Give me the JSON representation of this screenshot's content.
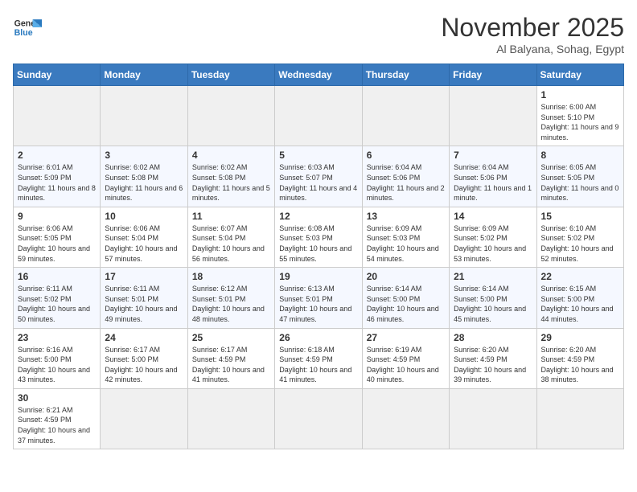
{
  "header": {
    "logo_general": "General",
    "logo_blue": "Blue",
    "title": "November 2025",
    "subtitle": "Al Balyana, Sohag, Egypt"
  },
  "weekdays": [
    "Sunday",
    "Monday",
    "Tuesday",
    "Wednesday",
    "Thursday",
    "Friday",
    "Saturday"
  ],
  "weeks": [
    [
      {
        "day": "",
        "info": ""
      },
      {
        "day": "",
        "info": ""
      },
      {
        "day": "",
        "info": ""
      },
      {
        "day": "",
        "info": ""
      },
      {
        "day": "",
        "info": ""
      },
      {
        "day": "",
        "info": ""
      },
      {
        "day": "1",
        "info": "Sunrise: 6:00 AM\nSunset: 5:10 PM\nDaylight: 11 hours and 9 minutes."
      }
    ],
    [
      {
        "day": "2",
        "info": "Sunrise: 6:01 AM\nSunset: 5:09 PM\nDaylight: 11 hours and 8 minutes."
      },
      {
        "day": "3",
        "info": "Sunrise: 6:02 AM\nSunset: 5:08 PM\nDaylight: 11 hours and 6 minutes."
      },
      {
        "day": "4",
        "info": "Sunrise: 6:02 AM\nSunset: 5:08 PM\nDaylight: 11 hours and 5 minutes."
      },
      {
        "day": "5",
        "info": "Sunrise: 6:03 AM\nSunset: 5:07 PM\nDaylight: 11 hours and 4 minutes."
      },
      {
        "day": "6",
        "info": "Sunrise: 6:04 AM\nSunset: 5:06 PM\nDaylight: 11 hours and 2 minutes."
      },
      {
        "day": "7",
        "info": "Sunrise: 6:04 AM\nSunset: 5:06 PM\nDaylight: 11 hours and 1 minute."
      },
      {
        "day": "8",
        "info": "Sunrise: 6:05 AM\nSunset: 5:05 PM\nDaylight: 11 hours and 0 minutes."
      }
    ],
    [
      {
        "day": "9",
        "info": "Sunrise: 6:06 AM\nSunset: 5:05 PM\nDaylight: 10 hours and 59 minutes."
      },
      {
        "day": "10",
        "info": "Sunrise: 6:06 AM\nSunset: 5:04 PM\nDaylight: 10 hours and 57 minutes."
      },
      {
        "day": "11",
        "info": "Sunrise: 6:07 AM\nSunset: 5:04 PM\nDaylight: 10 hours and 56 minutes."
      },
      {
        "day": "12",
        "info": "Sunrise: 6:08 AM\nSunset: 5:03 PM\nDaylight: 10 hours and 55 minutes."
      },
      {
        "day": "13",
        "info": "Sunrise: 6:09 AM\nSunset: 5:03 PM\nDaylight: 10 hours and 54 minutes."
      },
      {
        "day": "14",
        "info": "Sunrise: 6:09 AM\nSunset: 5:02 PM\nDaylight: 10 hours and 53 minutes."
      },
      {
        "day": "15",
        "info": "Sunrise: 6:10 AM\nSunset: 5:02 PM\nDaylight: 10 hours and 52 minutes."
      }
    ],
    [
      {
        "day": "16",
        "info": "Sunrise: 6:11 AM\nSunset: 5:02 PM\nDaylight: 10 hours and 50 minutes."
      },
      {
        "day": "17",
        "info": "Sunrise: 6:11 AM\nSunset: 5:01 PM\nDaylight: 10 hours and 49 minutes."
      },
      {
        "day": "18",
        "info": "Sunrise: 6:12 AM\nSunset: 5:01 PM\nDaylight: 10 hours and 48 minutes."
      },
      {
        "day": "19",
        "info": "Sunrise: 6:13 AM\nSunset: 5:01 PM\nDaylight: 10 hours and 47 minutes."
      },
      {
        "day": "20",
        "info": "Sunrise: 6:14 AM\nSunset: 5:00 PM\nDaylight: 10 hours and 46 minutes."
      },
      {
        "day": "21",
        "info": "Sunrise: 6:14 AM\nSunset: 5:00 PM\nDaylight: 10 hours and 45 minutes."
      },
      {
        "day": "22",
        "info": "Sunrise: 6:15 AM\nSunset: 5:00 PM\nDaylight: 10 hours and 44 minutes."
      }
    ],
    [
      {
        "day": "23",
        "info": "Sunrise: 6:16 AM\nSunset: 5:00 PM\nDaylight: 10 hours and 43 minutes."
      },
      {
        "day": "24",
        "info": "Sunrise: 6:17 AM\nSunset: 5:00 PM\nDaylight: 10 hours and 42 minutes."
      },
      {
        "day": "25",
        "info": "Sunrise: 6:17 AM\nSunset: 4:59 PM\nDaylight: 10 hours and 41 minutes."
      },
      {
        "day": "26",
        "info": "Sunrise: 6:18 AM\nSunset: 4:59 PM\nDaylight: 10 hours and 41 minutes."
      },
      {
        "day": "27",
        "info": "Sunrise: 6:19 AM\nSunset: 4:59 PM\nDaylight: 10 hours and 40 minutes."
      },
      {
        "day": "28",
        "info": "Sunrise: 6:20 AM\nSunset: 4:59 PM\nDaylight: 10 hours and 39 minutes."
      },
      {
        "day": "29",
        "info": "Sunrise: 6:20 AM\nSunset: 4:59 PM\nDaylight: 10 hours and 38 minutes."
      }
    ],
    [
      {
        "day": "30",
        "info": "Sunrise: 6:21 AM\nSunset: 4:59 PM\nDaylight: 10 hours and 37 minutes."
      },
      {
        "day": "",
        "info": ""
      },
      {
        "day": "",
        "info": ""
      },
      {
        "day": "",
        "info": ""
      },
      {
        "day": "",
        "info": ""
      },
      {
        "day": "",
        "info": ""
      },
      {
        "day": "",
        "info": ""
      }
    ]
  ]
}
